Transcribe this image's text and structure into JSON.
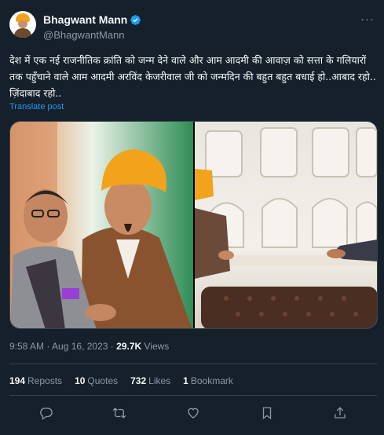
{
  "author": {
    "display_name": "Bhagwant Mann",
    "handle": "@BhagwantMann",
    "verified": true,
    "avatar_icon": "profile-photo-turban"
  },
  "tweet": {
    "text": "देश में एक नई राजनीतिक क्रांति को जन्म देने वाले और आम आदमी की आवाज़ को सत्ता के गलियारों तक पहुँचाने वाले आम आदमी अरविंद केजरीवाल जी को जन्मदिन की बहुत बहुत बधाई हो..आबाद रहो.. ज़िंदाबाद रहो..",
    "translate_label": "Translate post"
  },
  "meta": {
    "time": "9:58 AM",
    "date": "Aug 16, 2023",
    "separator": "·",
    "views_count": "29.7K",
    "views_label": "Views"
  },
  "stats": {
    "reposts_count": "194",
    "reposts_label": "Reposts",
    "quotes_count": "10",
    "quotes_label": "Quotes",
    "likes_count": "732",
    "likes_label": "Likes",
    "bookmarks_count": "1",
    "bookmarks_label": "Bookmark"
  },
  "actions": [
    "reply-icon",
    "repost-icon",
    "like-icon",
    "bookmark-icon",
    "share-icon"
  ],
  "colors": {
    "background": "#15202b",
    "text": "#f7f9f9",
    "secondary": "#8b98a5",
    "accent": "#1d9bf0",
    "border": "#38444d"
  }
}
